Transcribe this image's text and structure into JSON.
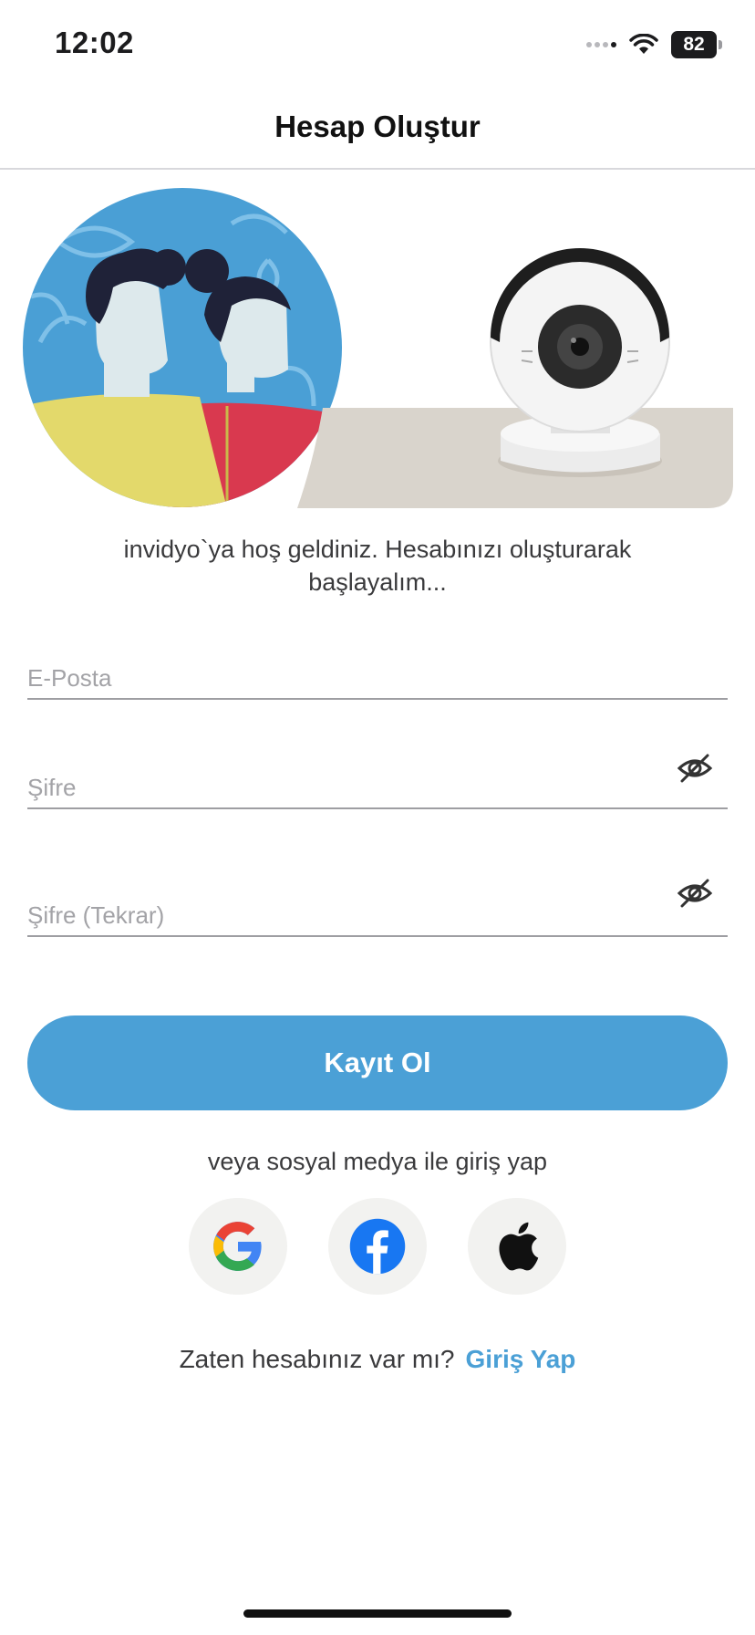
{
  "status": {
    "time": "12:02",
    "battery": "82"
  },
  "nav": {
    "title": "Hesap Oluştur"
  },
  "hero": {
    "illustration": "people-couple-and-baby-camera"
  },
  "welcome_text": "invidyo`ya hoş geldiniz. Hesabınızı oluşturarak başlayalım...",
  "form": {
    "email_placeholder": "E-Posta",
    "password_placeholder": "Şifre",
    "password_repeat_placeholder": "Şifre (Tekrar)",
    "eye_icon": "eye-slash-icon"
  },
  "register_button": "Kayıt Ol",
  "social": {
    "caption": "veya sosyal medya ile giriş yap",
    "providers": [
      "google-icon",
      "facebook-icon",
      "apple-icon"
    ]
  },
  "footer": {
    "question": "Zaten hesabınız var mı?",
    "login_link": "Giriş Yap"
  },
  "colors": {
    "accent": "#4ba0d6",
    "hero_blue": "#4a9fd5",
    "facebook": "#1877f2"
  }
}
